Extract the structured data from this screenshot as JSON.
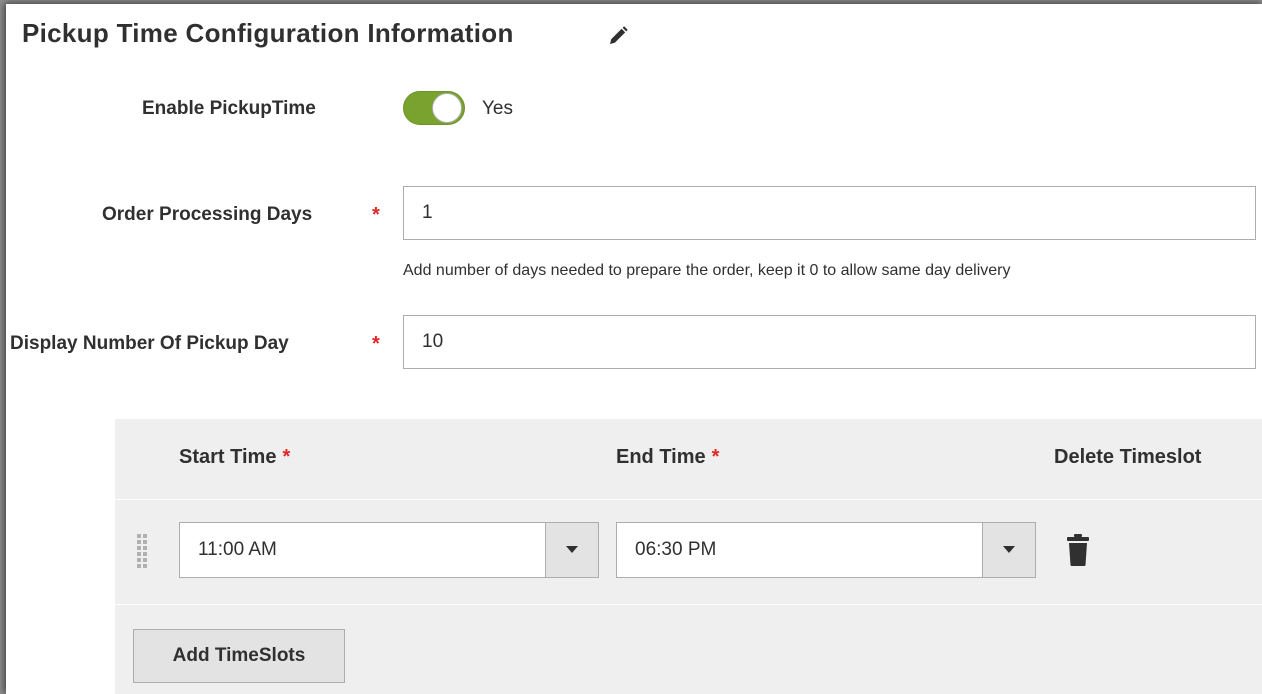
{
  "section": {
    "title": "Pickup Time Configuration Information",
    "edit_icon": "pencil-icon"
  },
  "enable_pickup": {
    "label": "Enable PickupTime",
    "value_label": "Yes",
    "enabled": true
  },
  "order_processing_days": {
    "label": "Order Processing Days",
    "required_mark": "*",
    "value": "1",
    "note": "Add number of days needed to prepare the order, keep it 0 to allow same day delivery"
  },
  "display_pickup_days": {
    "label": "Display Number Of Pickup Day",
    "required_mark": "*",
    "value": "10"
  },
  "timeslots": {
    "columns": {
      "start": "Start Time",
      "end": "End Time",
      "delete": "Delete Timeslot"
    },
    "required_mark": "*",
    "rows": [
      {
        "start": "11:00 AM",
        "end": "06:30 PM"
      }
    ],
    "add_button_label": "Add TimeSlots"
  },
  "colors": {
    "toggle_on": "#79a22e",
    "required": "#e22626",
    "grid_bg": "#efefef",
    "button_bg": "#e3e3e3"
  }
}
